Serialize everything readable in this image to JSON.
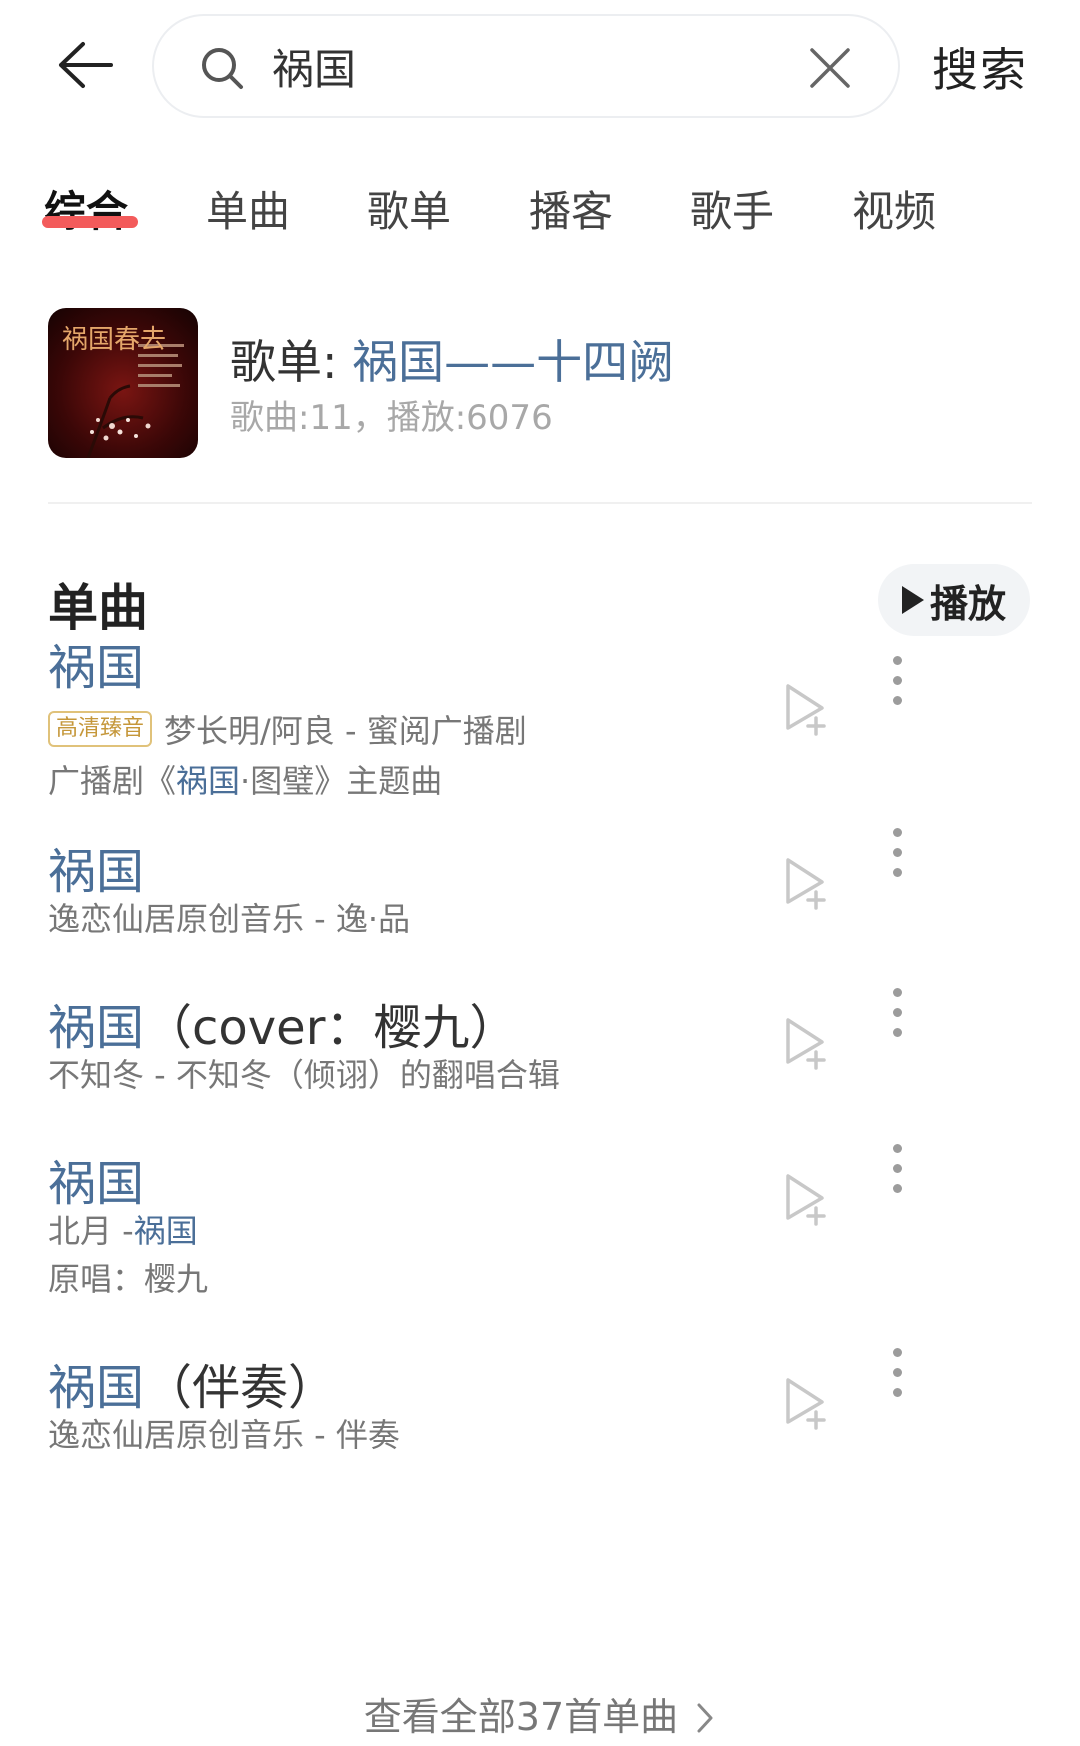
{
  "search": {
    "query": "祸国",
    "submit_label": "搜索"
  },
  "tabs": [
    {
      "label": "综合",
      "active": true
    },
    {
      "label": "单曲",
      "active": false
    },
    {
      "label": "歌单",
      "active": false
    },
    {
      "label": "播客",
      "active": false
    },
    {
      "label": "歌手",
      "active": false
    },
    {
      "label": "视频",
      "active": false
    }
  ],
  "playlist": {
    "prefix": "歌单: ",
    "name": "祸国——十四阙",
    "meta": "歌曲:11，播放:6076",
    "cover_text": "祸国春去"
  },
  "songs_section": {
    "title": "单曲",
    "play_label": "播放"
  },
  "songs": [
    {
      "title": "祸国",
      "title_suffix": "",
      "badge": "高清臻音",
      "sub1": "梦长明/阿良 - 蜜阅广播剧",
      "sub2_prefix": "广播剧《",
      "sub2_hl": "祸国",
      "sub2_suffix": "·图璧》主题曲"
    },
    {
      "title": "祸国",
      "title_suffix": "",
      "sub1": "逸恋仙居原创音乐 - 逸·品"
    },
    {
      "title": "祸国",
      "title_suffix": "（cover：樱九）",
      "sub1": "不知冬 - 不知冬（倾诩）的翻唱合辑"
    },
    {
      "title": "祸国",
      "title_suffix": "",
      "sub1_prefix": "北月 - ",
      "sub1_hl": "祸国",
      "sub2": "原唱：樱九"
    },
    {
      "title": "祸国",
      "title_suffix": "（伴奏）",
      "sub1": "逸恋仙居原创音乐 - 伴奏"
    }
  ],
  "view_all": "查看全部37首单曲",
  "colors": {
    "accent": "#4b6f98",
    "tab_underline": "#f35b5b",
    "badge": "#c5973a"
  },
  "icons": [
    "back-arrow-icon",
    "search-icon",
    "clear-icon",
    "play-icon",
    "add-to-playlist-icon",
    "more-vertical-icon",
    "chevron-right-icon"
  ]
}
